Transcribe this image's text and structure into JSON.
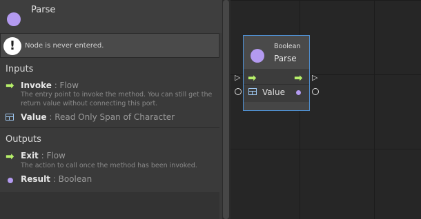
{
  "inspector": {
    "title": "Parse",
    "node_color": "#b39af0",
    "warning": "Node is never entered.",
    "warning_icon": "exclamation-icon",
    "inputs_title": "Inputs",
    "inputs": [
      {
        "name": "Invoke",
        "type": ": Flow",
        "description": "The entry point to invoke the method. You can still get the return value without connecting this port.",
        "icon": "flow-arrow-icon"
      },
      {
        "name": "Value",
        "type": ": Read Only Span of Character",
        "icon": "table-icon"
      }
    ],
    "outputs_title": "Outputs",
    "outputs": [
      {
        "name": "Exit",
        "type": ": Flow",
        "description": "The action to call once the method has been invoked.",
        "icon": "flow-arrow-icon"
      },
      {
        "name": "Result",
        "type": ": Boolean",
        "icon": "value-dot-icon"
      }
    ]
  },
  "graph_node": {
    "subtitle": "Boolean",
    "title": "Parse",
    "value_label": "Value",
    "accent": "#4f8fd0",
    "flow_color": "#b7f06a"
  }
}
